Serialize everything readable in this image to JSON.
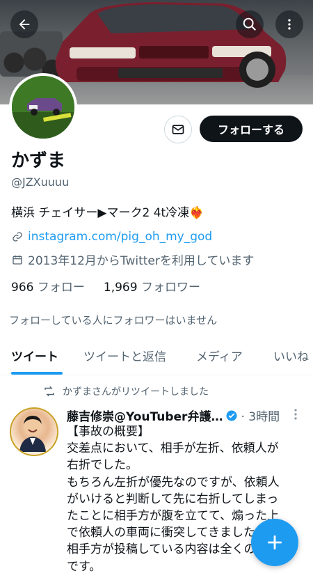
{
  "colors": {
    "accent": "#1d9bf0",
    "text": "#0f1419",
    "secondary": "#536471",
    "verified": "#1d9bf0"
  },
  "header": {
    "back_icon": "arrow-left-icon",
    "search_icon": "search-icon",
    "more_icon": "more-vertical-icon"
  },
  "profile": {
    "name": "かずま",
    "handle": "@JZXuuuu",
    "bio": "横浜 チェイサー▶︎マーク2  4t冷凍❤️‍🔥",
    "link": "instagram.com/pig_oh_my_god",
    "joined": "2013年12月からTwitterを利用しています",
    "following_count": "966",
    "following_label": "フォロー",
    "followers_count": "1,969",
    "followers_label": "フォロワー",
    "no_mutual": "フォローしている人にフォロワーはいません",
    "follow_button": "フォローする"
  },
  "tabs": [
    {
      "label": "ツイート",
      "active": true
    },
    {
      "label": "ツイートと返信",
      "active": false
    },
    {
      "label": "メディア",
      "active": false
    },
    {
      "label": "いいね",
      "active": false
    }
  ],
  "tweet": {
    "retweet_by": "かずまさんがリツイートしました",
    "author": "藤吉修崇@YouTuber弁護…",
    "verified": true,
    "time": "· 3時間",
    "lines": [
      "【事故の概要】",
      "交差点において、相手が左折、依頼人が",
      "右折でした。",
      "もちろん左折が優先なのですが、依頼人",
      "がいけると判断して先に右折してしまっ",
      "たことに相手方が腹を立てて、煽った上",
      "で依頼人の車両に衝突してきました。",
      "相手方が投稿している内容は全くの虚偽",
      "です。"
    ]
  },
  "fab": {
    "icon": "plus-icon"
  }
}
